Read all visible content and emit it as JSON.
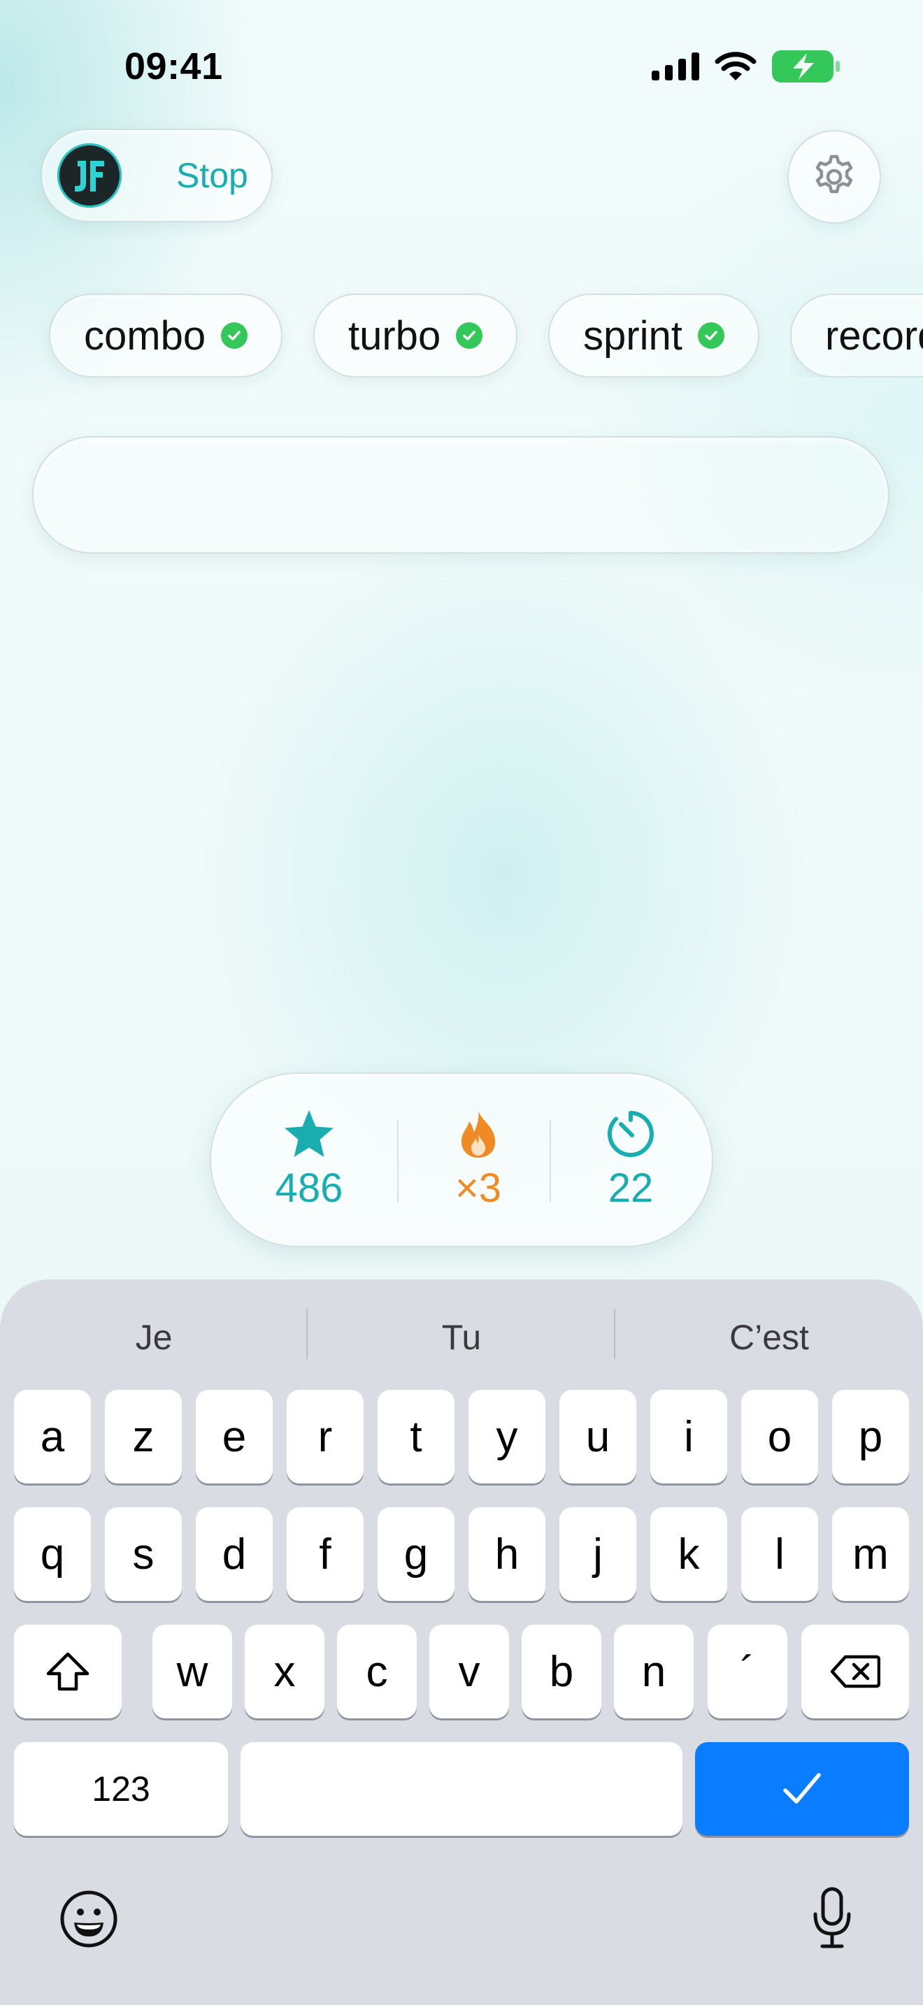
{
  "status_bar": {
    "time": "09:41"
  },
  "header": {
    "stop_label": "Stop"
  },
  "tags": [
    {
      "label": "combo"
    },
    {
      "label": "turbo"
    },
    {
      "label": "sprint"
    },
    {
      "label": "record"
    }
  ],
  "input": {
    "value": "",
    "placeholder": ""
  },
  "stats": {
    "score": "486",
    "multiplier": "×3",
    "timer": "22"
  },
  "keyboard": {
    "suggestions": [
      "Je",
      "Tu",
      "C’est"
    ],
    "row1": [
      "a",
      "z",
      "e",
      "r",
      "t",
      "y",
      "u",
      "i",
      "o",
      "p"
    ],
    "row2": [
      "q",
      "s",
      "d",
      "f",
      "g",
      "h",
      "j",
      "k",
      "l",
      "m"
    ],
    "row3": [
      "w",
      "x",
      "c",
      "v",
      "b",
      "n",
      "´"
    ],
    "numbers_label": "123"
  },
  "colors": {
    "accent": "#18aeb0",
    "flame": "#f08a24",
    "check": "#34c759",
    "return_key": "#0a7cff",
    "battery": "#34c759"
  },
  "icons": {
    "status": [
      "signal-icon",
      "wifi-icon",
      "battery-charging-icon"
    ],
    "settings": "gear-icon",
    "stats": [
      "star-icon",
      "flame-icon",
      "timer-icon"
    ],
    "keyboard": [
      "shift-icon",
      "backspace-icon",
      "checkmark-icon",
      "emoji-icon",
      "microphone-icon"
    ]
  }
}
